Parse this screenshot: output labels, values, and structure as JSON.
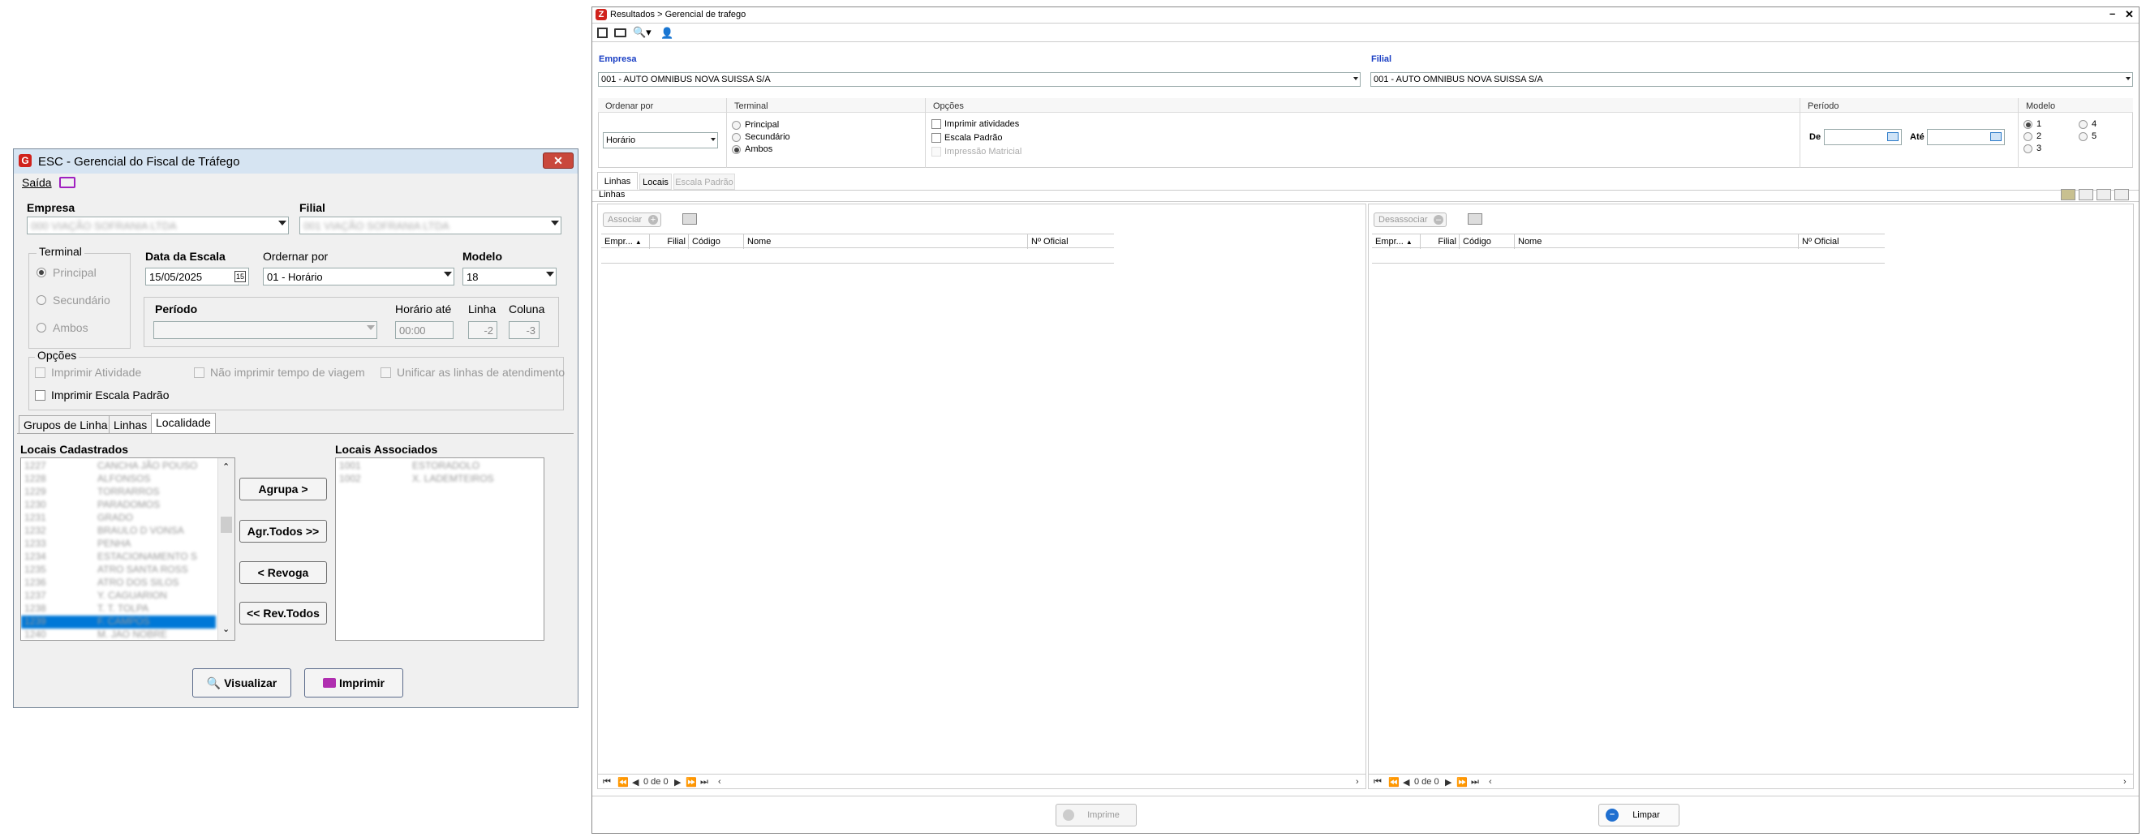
{
  "left_window": {
    "title": "ESC - Gerencial do Fiscal de Tráfego",
    "logo": "G",
    "close": "✕",
    "menu_saida": "Saída",
    "empresa_label": "Empresa",
    "empresa_value": "000 VIAÇÃO SOFRANIA LTDA",
    "filial_label": "Filial",
    "filial_value": "001 VIAÇÃO SOFRANIA LTDA",
    "terminal_label": "Terminal",
    "terminal_options": [
      "Principal",
      "Secundário",
      "Ambos"
    ],
    "data_escala_label": "Data da Escala",
    "data_escala_value": "15/05/2025",
    "ordenar_label": "Ordernar por",
    "ordenar_value": "01 - Horário",
    "modelo_label": "Modelo",
    "modelo_value": "18",
    "periodo_label": "Período",
    "horario_ate_label": "Horário até",
    "horario_ate_value": "00:00",
    "linha_label": "Linha",
    "linha_value": "-2",
    "coluna_label": "Coluna",
    "coluna_value": "-3",
    "opcoes_label": "Opções",
    "opt_imprimir_atividade": "Imprimir Atividade",
    "opt_nao_imprimir": "Não imprimir tempo de viagem",
    "opt_unificar": "Unificar as linhas de atendimento",
    "opt_escala_padrao": "Imprimir Escala Padrão",
    "tabs": [
      "Grupos de Linha",
      "Linhas",
      "Localidade"
    ],
    "locais_cadastrados_label": "Locais Cadastrados",
    "locais_associados_label": "Locais Associados",
    "locais_cadastrados": [
      [
        "1227",
        "CANCHA JÃO POUSO"
      ],
      [
        "1228",
        "ALFONSOS"
      ],
      [
        "1229",
        "TORRARROS"
      ],
      [
        "1230",
        "PARADOMOS"
      ],
      [
        "1231",
        "GRADO"
      ],
      [
        "1232",
        "BRAULO D VONSA"
      ],
      [
        "1233",
        "PENHA"
      ],
      [
        "1234",
        "ESTACIONAMENTO S"
      ],
      [
        "1235",
        "ATRO SANTA ROSS"
      ],
      [
        "1236",
        "ATRO DOS SILOS"
      ],
      [
        "1237",
        "Y. CAGUARION"
      ],
      [
        "1238",
        "T. T. TOLPA"
      ],
      [
        "1239",
        "F. CAMPOS"
      ],
      [
        "1240",
        "M. JAO NOBRE"
      ]
    ],
    "locais_associados": [
      [
        "1001",
        "ESTORADOLO"
      ],
      [
        "1002",
        "X. LADEMTEIROS"
      ]
    ],
    "btn_agrupa": "Agrupa >",
    "btn_agr_todos": "Agr.Todos >>",
    "btn_revoga": "< Revoga",
    "btn_rev_todos": "<< Rev.Todos",
    "btn_visualizar": "Visualizar",
    "btn_imprimir": "Imprimir"
  },
  "right_window": {
    "title": "Resultados > Gerencial de trafego",
    "logo": "Z",
    "empresa_label": "Empresa",
    "empresa_value": "001 - AUTO OMNIBUS NOVA SUISSA S/A",
    "filial_label": "Filial",
    "filial_value": "001 - AUTO OMNIBUS NOVA SUISSA S/A",
    "ordenar_label": "Ordenar por",
    "ordenar_value": "Horário",
    "terminal_label": "Terminal",
    "terminal_options": [
      "Principal",
      "Secundário",
      "Ambos"
    ],
    "opcoes_label": "Opções",
    "opt_imprimir_atividades": "Imprimir atividades",
    "opt_escala_padrao": "Escala Padrão",
    "opt_impressao_matricial": "Impressão Matricial",
    "periodo_label": "Período",
    "de_label": "De",
    "ate_label": "Até",
    "modelo_label": "Modelo",
    "modelo_options": [
      "1",
      "2",
      "3",
      "4",
      "5"
    ],
    "tabs": [
      "Linhas",
      "Locais",
      "Escala Padrão"
    ],
    "section_label": "Linhas",
    "btn_associar": "Associar",
    "btn_desassociar": "Desassociar",
    "columns": [
      "Empr...",
      "Filial",
      "Código",
      "Nome",
      "Nº Oficial"
    ],
    "pager_text": "0 de 0",
    "btn_imprime": "Imprime",
    "btn_limpar": "Limpar"
  }
}
